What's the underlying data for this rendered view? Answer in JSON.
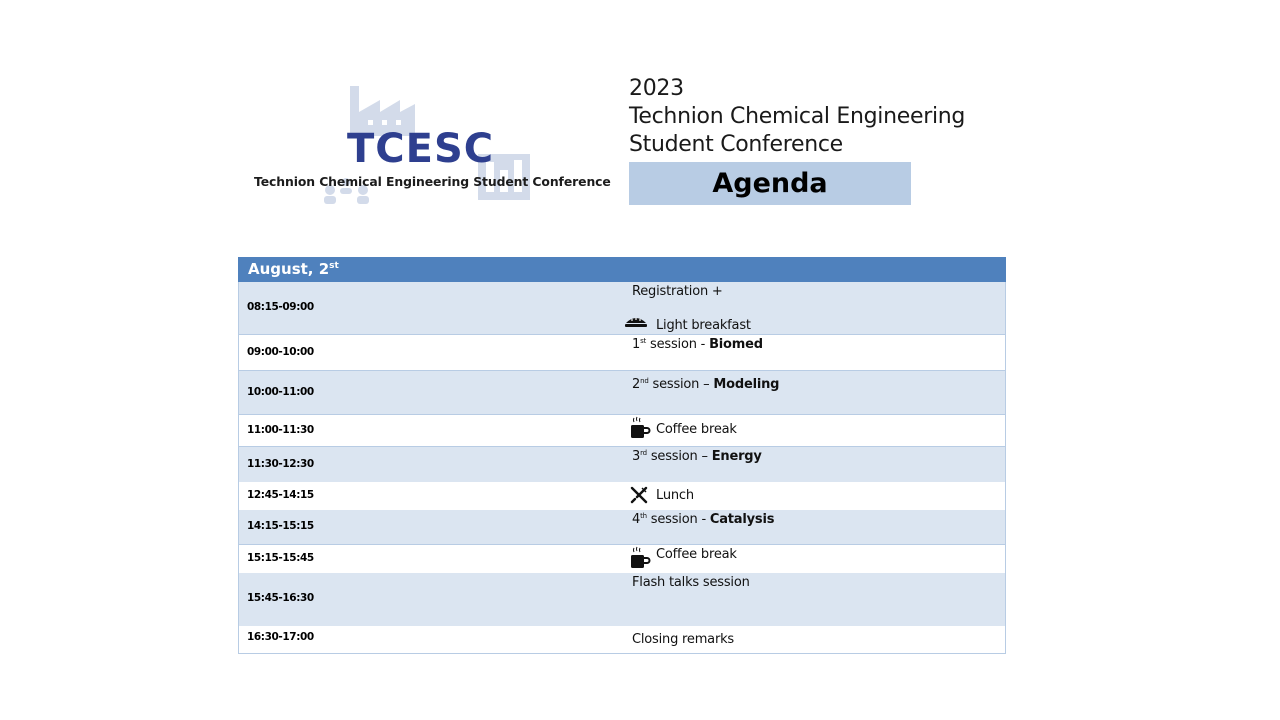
{
  "logo": {
    "acronym": "TCESC",
    "full_name": "Technion Chemical Engineering Student Conference"
  },
  "title": {
    "year": "2023",
    "line1": "Technion Chemical Engineering",
    "line2": "Student Conference",
    "agenda_label": "Agenda"
  },
  "schedule": {
    "date_main": "August, 2",
    "date_suffix": "st",
    "rows": [
      {
        "time": "08:15-09:00",
        "line1": "Registration +",
        "line2": "Light breakfast",
        "icon": "breakfast-icon"
      },
      {
        "time": "09:00-10:00",
        "ord": "1",
        "ord_suffix": "st",
        "pre": " session - ",
        "topic": "Biomed"
      },
      {
        "time": "10:00-11:00",
        "ord": "2",
        "ord_suffix": "nd",
        "pre": " session – ",
        "topic": "Modeling"
      },
      {
        "time": "11:00-11:30",
        "text": "Coffee break",
        "icon": "coffee-icon"
      },
      {
        "time": "11:30-12:30",
        "ord": "3",
        "ord_suffix": "rd",
        "pre": " session – ",
        "topic": "Energy"
      },
      {
        "time": "12:45-14:15",
        "text": "Lunch",
        "icon": "cutlery-icon"
      },
      {
        "time": "14:15-15:15",
        "ord": "4",
        "ord_suffix": "th",
        "pre": " session - ",
        "topic": "Catalysis"
      },
      {
        "time": "15:15-15:45",
        "text": "Coffee break",
        "icon": "coffee-icon"
      },
      {
        "time": "15:45-16:30",
        "text": "Flash talks session"
      },
      {
        "time": "16:30-17:00",
        "text": "Closing remarks"
      }
    ]
  },
  "colors": {
    "header_blue": "#4f81bd",
    "band_light": "#dbe5f1",
    "agenda_box": "#b8cce4",
    "logo_navy": "#2e3f8f"
  }
}
